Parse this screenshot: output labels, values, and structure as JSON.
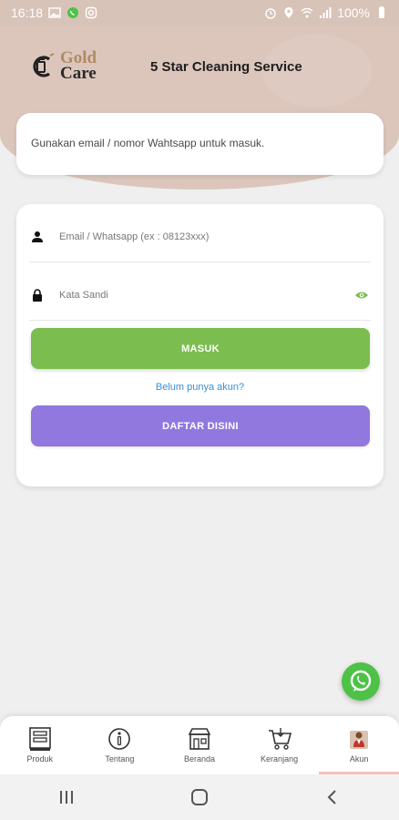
{
  "status_bar": {
    "time": "16:18",
    "battery": "100%"
  },
  "header": {
    "logo_line1": "Gold",
    "logo_line2": "Care",
    "title": "5 Star Cleaning Service"
  },
  "notice": {
    "text": "Gunakan email / nomor Wahtsapp untuk masuk."
  },
  "form": {
    "email_placeholder": "Email / Whatsapp (ex : 08123xxx)",
    "password_placeholder": "Kata Sandi",
    "login_label": "MASUK",
    "register_prompt": "Belum punya akun?",
    "register_label": "DAFTAR DISINI"
  },
  "bottom_nav": {
    "items": [
      {
        "label": "Produk",
        "icon": "product-icon"
      },
      {
        "label": "Tentang",
        "icon": "info-icon"
      },
      {
        "label": "Beranda",
        "icon": "store-icon"
      },
      {
        "label": "Keranjang",
        "icon": "cart-icon"
      },
      {
        "label": "Akun",
        "icon": "account-icon",
        "active": true
      }
    ]
  },
  "colors": {
    "brand_gold": "#b08a64",
    "header_bg": "#dcc6bc",
    "login_green": "#7cbd50",
    "register_purple": "#9178de",
    "link_blue": "#3a8ed0",
    "whatsapp_green": "#4dc247"
  }
}
